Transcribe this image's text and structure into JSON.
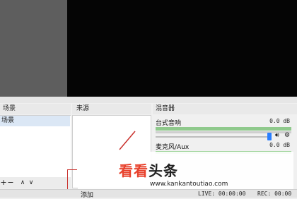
{
  "docks": {
    "scenes_title": "场景",
    "sources_title": "来源",
    "mixer_title": "混音器"
  },
  "scenes": {
    "items": [
      {
        "label": "场景"
      }
    ],
    "toolbar": {
      "add": "+",
      "remove": "−",
      "up": "∧",
      "down": "∨"
    }
  },
  "mixer": {
    "channels": [
      {
        "name": "台式音响",
        "db": "0.0 dB"
      },
      {
        "name": "麦克风/Aux",
        "db": "0.0 dB"
      }
    ]
  },
  "watermark": {
    "brand_part1": "看看",
    "brand_part2": "头条",
    "url": "www.kankantoutiao.com"
  },
  "statusbar": {
    "add_label": "添加",
    "live": "LIVE: 00:00:00",
    "rec": "REC: 00:00"
  },
  "colors": {
    "accent": "#2a7fff",
    "annotation": "#c9302c",
    "brand_red": "#e8412c"
  }
}
